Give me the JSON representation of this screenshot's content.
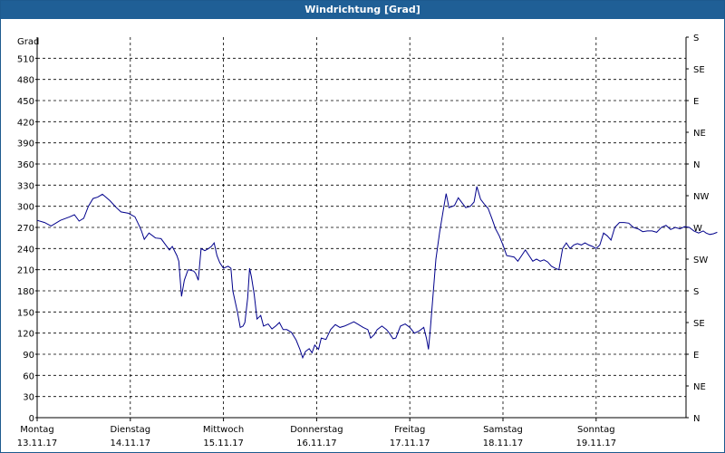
{
  "window": {
    "title": "Windrichtung [Grad]"
  },
  "chart_data": {
    "type": "line",
    "title": "Windrichtung [Grad]",
    "ylabel": "Grad",
    "ylim": [
      0,
      540
    ],
    "yticks": [
      0,
      30,
      60,
      90,
      120,
      150,
      180,
      210,
      240,
      270,
      300,
      330,
      360,
      390,
      420,
      450,
      480,
      510
    ],
    "right_axis_labels": [
      "N",
      "NE",
      "E",
      "SE",
      "S",
      "SW",
      "W",
      "NW",
      "N",
      "NE",
      "E",
      "SE",
      "S"
    ],
    "x_labels": [
      {
        "day": "Montag",
        "date": "13.11.17"
      },
      {
        "day": "Dienstag",
        "date": "14.11.17"
      },
      {
        "day": "Mittwoch",
        "date": "15.11.17"
      },
      {
        "day": "Donnerstag",
        "date": "16.11.17"
      },
      {
        "day": "Freitag",
        "date": "17.11.17"
      },
      {
        "day": "Samstag",
        "date": "18.11.17"
      },
      {
        "day": "Sonntag",
        "date": "19.11.17"
      }
    ],
    "grid": true,
    "colors": {
      "line": "#00008b",
      "title_bar": "#1f5f96"
    },
    "series": [
      {
        "x_unit": "days since Montag 13.11.17 00:00",
        "points": [
          [
            0.0,
            280
          ],
          [
            0.08,
            277
          ],
          [
            0.15,
            272
          ],
          [
            0.25,
            280
          ],
          [
            0.35,
            285
          ],
          [
            0.4,
            288
          ],
          [
            0.45,
            279
          ],
          [
            0.5,
            283
          ],
          [
            0.55,
            300
          ],
          [
            0.6,
            311
          ],
          [
            0.65,
            313
          ],
          [
            0.7,
            317
          ],
          [
            0.78,
            308
          ],
          [
            0.85,
            298
          ],
          [
            0.9,
            292
          ],
          [
            0.98,
            290
          ],
          [
            1.05,
            285
          ],
          [
            1.1,
            271
          ],
          [
            1.12,
            265
          ],
          [
            1.15,
            253
          ],
          [
            1.2,
            262
          ],
          [
            1.27,
            255
          ],
          [
            1.33,
            254
          ],
          [
            1.38,
            245
          ],
          [
            1.42,
            238
          ],
          [
            1.45,
            243
          ],
          [
            1.5,
            230
          ],
          [
            1.52,
            222
          ],
          [
            1.55,
            172
          ],
          [
            1.58,
            195
          ],
          [
            1.62,
            210
          ],
          [
            1.68,
            208
          ],
          [
            1.7,
            205
          ],
          [
            1.73,
            195
          ],
          [
            1.76,
            240
          ],
          [
            1.8,
            237
          ],
          [
            1.84,
            240
          ],
          [
            1.87,
            243
          ],
          [
            1.9,
            248
          ],
          [
            1.93,
            230
          ],
          [
            1.96,
            220
          ],
          [
            2.0,
            212
          ],
          [
            2.05,
            215
          ],
          [
            2.08,
            212
          ],
          [
            2.1,
            180
          ],
          [
            2.15,
            150
          ],
          [
            2.18,
            128
          ],
          [
            2.21,
            130
          ],
          [
            2.23,
            135
          ],
          [
            2.26,
            170
          ],
          [
            2.28,
            212
          ],
          [
            2.3,
            200
          ],
          [
            2.33,
            175
          ],
          [
            2.36,
            140
          ],
          [
            2.4,
            145
          ],
          [
            2.43,
            130
          ],
          [
            2.48,
            133
          ],
          [
            2.52,
            126
          ],
          [
            2.56,
            130
          ],
          [
            2.6,
            135
          ],
          [
            2.64,
            125
          ],
          [
            2.68,
            125
          ],
          [
            2.73,
            121
          ],
          [
            2.78,
            110
          ],
          [
            2.82,
            97
          ],
          [
            2.85,
            85
          ],
          [
            2.88,
            94
          ],
          [
            2.92,
            98
          ],
          [
            2.95,
            92
          ],
          [
            2.98,
            103
          ],
          [
            3.02,
            97
          ],
          [
            3.05,
            113
          ],
          [
            3.1,
            111
          ],
          [
            3.15,
            125
          ],
          [
            3.2,
            132
          ],
          [
            3.25,
            128
          ],
          [
            3.3,
            130
          ],
          [
            3.35,
            133
          ],
          [
            3.4,
            136
          ],
          [
            3.45,
            132
          ],
          [
            3.5,
            128
          ],
          [
            3.55,
            125
          ],
          [
            3.58,
            113
          ],
          [
            3.62,
            118
          ],
          [
            3.65,
            125
          ],
          [
            3.7,
            130
          ],
          [
            3.75,
            125
          ],
          [
            3.78,
            120
          ],
          [
            3.82,
            112
          ],
          [
            3.85,
            113
          ],
          [
            3.9,
            130
          ],
          [
            3.95,
            133
          ],
          [
            4.0,
            128
          ],
          [
            4.05,
            120
          ],
          [
            4.1,
            123
          ],
          [
            4.15,
            128
          ],
          [
            4.18,
            112
          ],
          [
            4.2,
            97
          ],
          [
            4.22,
            125
          ],
          [
            4.25,
            175
          ],
          [
            4.28,
            225
          ],
          [
            4.32,
            263
          ],
          [
            4.36,
            295
          ],
          [
            4.39,
            318
          ],
          [
            4.42,
            298
          ],
          [
            4.48,
            301
          ],
          [
            4.52,
            312
          ],
          [
            4.56,
            305
          ],
          [
            4.6,
            298
          ],
          [
            4.65,
            300
          ],
          [
            4.69,
            306
          ],
          [
            4.72,
            328
          ],
          [
            4.76,
            310
          ],
          [
            4.8,
            303
          ],
          [
            4.84,
            297
          ],
          [
            4.88,
            283
          ],
          [
            4.92,
            268
          ],
          [
            4.96,
            258
          ],
          [
            5.0,
            245
          ],
          [
            5.04,
            230
          ],
          [
            5.08,
            229
          ],
          [
            5.12,
            228
          ],
          [
            5.16,
            222
          ],
          [
            5.2,
            230
          ],
          [
            5.24,
            238
          ],
          [
            5.28,
            230
          ],
          [
            5.32,
            222
          ],
          [
            5.36,
            225
          ],
          [
            5.4,
            222
          ],
          [
            5.44,
            224
          ],
          [
            5.48,
            221
          ],
          [
            5.52,
            215
          ],
          [
            5.56,
            212
          ],
          [
            5.6,
            210
          ],
          [
            5.64,
            240
          ],
          [
            5.68,
            248
          ],
          [
            5.72,
            240
          ],
          [
            5.76,
            245
          ],
          [
            5.8,
            247
          ],
          [
            5.84,
            245
          ],
          [
            5.88,
            248
          ],
          [
            5.92,
            245
          ],
          [
            5.96,
            243
          ],
          [
            6.0,
            240
          ],
          [
            6.04,
            245
          ],
          [
            6.08,
            262
          ],
          [
            6.12,
            258
          ],
          [
            6.16,
            252
          ],
          [
            6.2,
            270
          ],
          [
            6.25,
            277
          ],
          [
            6.3,
            277
          ],
          [
            6.35,
            276
          ],
          [
            6.4,
            270
          ],
          [
            6.45,
            268
          ],
          [
            6.5,
            264
          ],
          [
            6.55,
            265
          ],
          [
            6.6,
            265
          ],
          [
            6.65,
            263
          ],
          [
            6.7,
            270
          ],
          [
            6.75,
            273
          ],
          [
            6.8,
            267
          ],
          [
            6.85,
            270
          ],
          [
            6.9,
            268
          ],
          [
            6.95,
            271
          ],
          [
            7.0,
            270
          ],
          [
            7.05,
            265
          ],
          [
            7.1,
            262
          ],
          [
            7.15,
            265
          ],
          [
            7.18,
            262
          ],
          [
            7.22,
            260
          ],
          [
            7.26,
            261
          ],
          [
            7.3,
            263
          ]
        ]
      }
    ]
  }
}
